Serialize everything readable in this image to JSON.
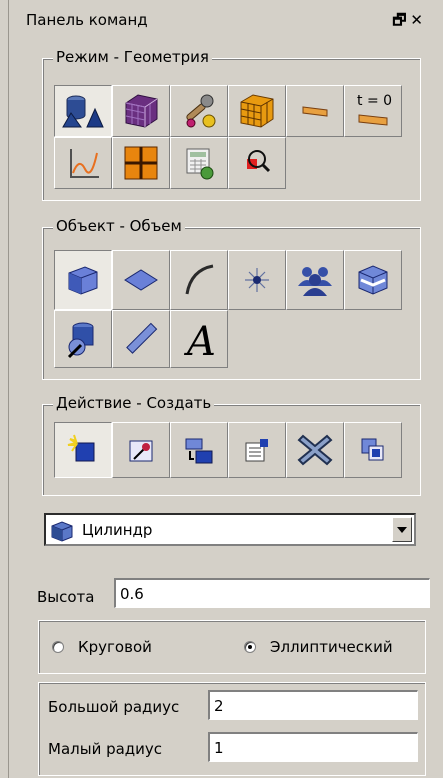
{
  "panel": {
    "title": "Панель команд",
    "float_icon": "restore-icon",
    "close_icon": "close-icon"
  },
  "mode_group": {
    "legend": "Режим - Геометрия",
    "buttons": [
      {
        "icon": "geometry-shapes-icon"
      },
      {
        "icon": "mesh-cube-icon"
      },
      {
        "icon": "tools-icon"
      },
      {
        "icon": "grid-cube-icon"
      },
      {
        "icon": "boundary-strip-icon"
      },
      {
        "icon": "time-zero-icon",
        "label": "t = 0"
      },
      {
        "icon": "plot-graph-icon"
      },
      {
        "icon": "mesh-grid-icon"
      },
      {
        "icon": "calculator-icon"
      },
      {
        "icon": "zoom-examine-icon"
      }
    ]
  },
  "object_group": {
    "legend": "Объект - Объем",
    "buttons": [
      {
        "icon": "volume-cube-icon"
      },
      {
        "icon": "face-icon"
      },
      {
        "icon": "edge-curve-icon"
      },
      {
        "icon": "vertex-point-icon"
      },
      {
        "icon": "group-icon"
      },
      {
        "icon": "cube-section-icon"
      },
      {
        "icon": "body-edit-icon"
      },
      {
        "icon": "measure-ruler-icon"
      },
      {
        "icon": "text-annotation-icon",
        "label": "A"
      }
    ]
  },
  "action_group": {
    "legend": "Действие - Создать",
    "buttons": [
      {
        "icon": "create-icon"
      },
      {
        "icon": "edit-icon"
      },
      {
        "icon": "move-copy-icon"
      },
      {
        "icon": "properties-icon"
      },
      {
        "icon": "delete-icon"
      },
      {
        "icon": "copy-icon"
      }
    ]
  },
  "shape_select": {
    "value": "Цилиндр",
    "icon": "cylinder-cube-icon"
  },
  "height": {
    "label": "Высота",
    "value": "0.6"
  },
  "section_type": {
    "circular_label": "Круговой",
    "elliptical_label": "Эллиптический",
    "selected": "elliptical"
  },
  "radii": {
    "major_label": "Большой радиус",
    "major_value": "2",
    "minor_label": "Малый радиус",
    "minor_value": "1"
  }
}
